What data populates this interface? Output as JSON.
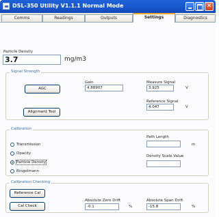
{
  "window": {
    "title": "DSL-350 Utility V1.1.1 Normal Mode",
    "minimize": "",
    "maximize": "",
    "close": "✕"
  },
  "tabs": [
    {
      "label": "Comms"
    },
    {
      "label": "Readings"
    },
    {
      "label": "Outputs"
    },
    {
      "label": "Settings",
      "active": true
    },
    {
      "label": "Diagnostics"
    }
  ],
  "particle_density": {
    "label": "Particle Density",
    "value": "3.7",
    "units": "mg/m3"
  },
  "signal_strength": {
    "legend": "Signal Strength",
    "agc_button": "AGC",
    "alignment_button": "Alignment Tool",
    "gain_label": "Gain",
    "gain_value": "4.88907",
    "measure_label": "Measure Signal",
    "measure_value": "3.925",
    "measure_units": "V",
    "reference_label": "Reference Signal",
    "reference_value": "4.047",
    "reference_units": "V"
  },
  "calibration": {
    "legend": "Calibration",
    "options": [
      {
        "label": "Transmission",
        "checked": false
      },
      {
        "label": "Opacity",
        "checked": false
      },
      {
        "label": "Particle Density",
        "checked": true
      },
      {
        "label": "Ringelmann",
        "checked": false
      }
    ],
    "path_length_label": "Path Length",
    "path_length_value": "",
    "path_length_units": "m",
    "density_scale_label": "Density Scale Value",
    "density_scale_value": ""
  },
  "calibration_checking": {
    "legend": "Calibration Checking",
    "reference_button": "Reference Cal",
    "calcheck_button": "Cal Check",
    "zero_drift_label": "Absolute Zero Drift",
    "zero_drift_value": "-0.1",
    "zero_drift_units": "%",
    "span_drift_label": "Absolute Span Drift",
    "span_drift_value": "-15.8",
    "span_drift_units": "%"
  }
}
